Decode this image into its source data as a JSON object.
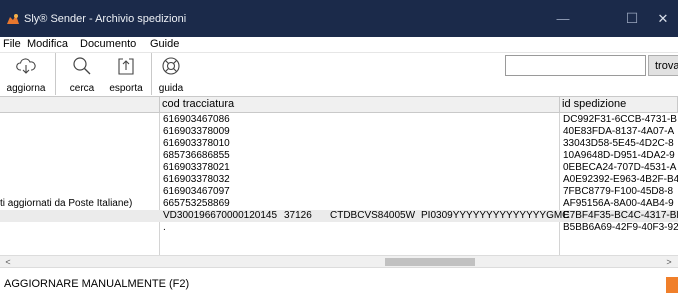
{
  "window": {
    "title": "Sly® Sender - Archivio spedizioni",
    "minimize_glyph": "—",
    "maximize_glyph": "☐",
    "close_glyph": "✕"
  },
  "menu": [
    "File",
    "Modifica",
    "Documento",
    "Guide"
  ],
  "toolbar": {
    "refresh_label": "aggiorna",
    "search_label": "cerca",
    "export_label": "esporta",
    "help_label": "guida",
    "search_value": "",
    "find_label": "trova"
  },
  "table": {
    "columns": [
      "cod tracciatura",
      "id spedizione"
    ],
    "rows": [
      {
        "left": "",
        "cod": "616903467086",
        "extra": [],
        "id": "DC992F31-6CCB-4731-B"
      },
      {
        "left": "",
        "cod": "616903378009",
        "extra": [],
        "id": "40E83FDA-8137-4A07-A"
      },
      {
        "left": "",
        "cod": "616903378010",
        "extra": [],
        "id": "33043D58-5E45-4D2C-8"
      },
      {
        "left": "",
        "cod": "685736686855",
        "extra": [],
        "id": "10A9648D-D951-4DA2-9"
      },
      {
        "left": "",
        "cod": "616903378021",
        "extra": [],
        "id": "0EBECA24-707D-4531-A"
      },
      {
        "left": "",
        "cod": "616903378032",
        "extra": [],
        "id": "A0E92392-E963-4B2F-B4"
      },
      {
        "left": "",
        "cod": "616903467097",
        "extra": [],
        "id": "7FBC8779-F100-45D8-8"
      },
      {
        "left": "ti aggiornati da Poste Italiane)",
        "cod": "665753258869",
        "extra": [],
        "id": "AF95156A-8A00-4AB4-9"
      },
      {
        "left": "",
        "cod": "VD300196670000120145",
        "extra": [
          "37126",
          "CTDBCVS84005W",
          "PI0309YYYYYYYYYYYYYYGMC"
        ],
        "id": "E7BF4F35-BC4C-4317-BE"
      },
      {
        "left": "",
        "cod": ".",
        "extra": [],
        "id": "B5BB6A69-42F9-40F3-92"
      }
    ]
  },
  "scrollbar": {
    "left_arrow": "<",
    "right_arrow": ">"
  },
  "status": {
    "text": "AGGIORNARE MANUALMENTE (F2)"
  },
  "colors": {
    "titlebar": "#1b2a4a",
    "status_indicator": "#f07f2a",
    "app_icon": "#e8772e"
  }
}
